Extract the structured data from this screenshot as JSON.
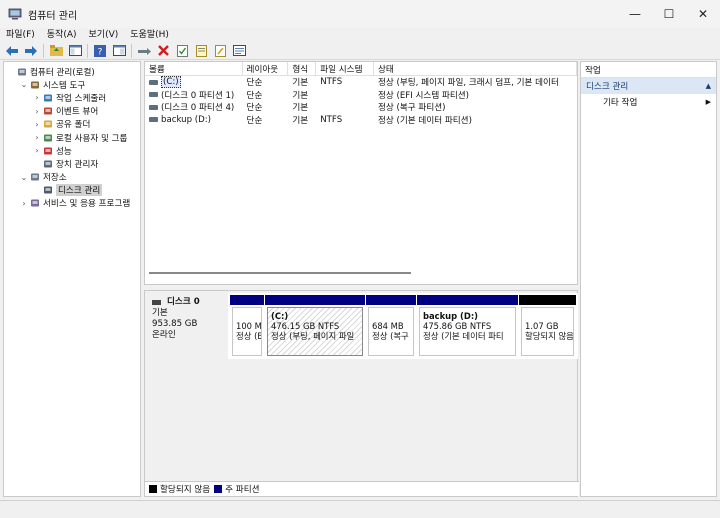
{
  "window": {
    "title": "컴퓨터 관리",
    "minimize": "—",
    "maximize": "☐",
    "close": "✕"
  },
  "menu": [
    "파일(F)",
    "동작(A)",
    "보기(V)",
    "도움말(H)"
  ],
  "tree": [
    {
      "label": "컴퓨터 관리(로컬)",
      "indent": 0,
      "arrow": "",
      "icon": "computer-icon"
    },
    {
      "label": "시스템 도구",
      "indent": 1,
      "arrow": "⌄",
      "icon": "tools-icon"
    },
    {
      "label": "작업 스케줄러",
      "indent": 2,
      "arrow": "›",
      "icon": "clock-icon"
    },
    {
      "label": "이벤트 뷰어",
      "indent": 2,
      "arrow": "›",
      "icon": "event-viewer-icon"
    },
    {
      "label": "공유 폴더",
      "indent": 2,
      "arrow": "›",
      "icon": "shared-folder-icon"
    },
    {
      "label": "로컬 사용자 및 그룹",
      "indent": 2,
      "arrow": "›",
      "icon": "users-icon"
    },
    {
      "label": "성능",
      "indent": 2,
      "arrow": "›",
      "icon": "performance-icon"
    },
    {
      "label": "장치 관리자",
      "indent": 2,
      "arrow": "",
      "icon": "device-manager-icon"
    },
    {
      "label": "저장소",
      "indent": 1,
      "arrow": "⌄",
      "icon": "storage-icon"
    },
    {
      "label": "디스크 관리",
      "indent": 2,
      "arrow": "",
      "icon": "disk-management-icon",
      "selected": true
    },
    {
      "label": "서비스 및 응용 프로그램",
      "indent": 1,
      "arrow": "›",
      "icon": "services-icon"
    }
  ],
  "volumes": {
    "headers": [
      "볼륨",
      "레이아웃",
      "형식",
      "파일 시스템",
      "상태"
    ],
    "rows": [
      [
        "(C:)",
        "단순",
        "기본",
        "NTFS",
        "정상 (부팅, 페이지 파일, 크래시 덤프, 기본 데이터"
      ],
      [
        "(디스크 0 파티션 1)",
        "단순",
        "기본",
        "",
        "정상 (EFI 시스템 파티션)"
      ],
      [
        "(디스크 0 파티션 4)",
        "단순",
        "기본",
        "",
        "정상 (복구 파티션)"
      ],
      [
        "backup (D:)",
        "단순",
        "기본",
        "NTFS",
        "정상 (기본 데이터 파티션)"
      ]
    ]
  },
  "disk": {
    "name": "디스크 0",
    "type": "기본",
    "size": "953.85 GB",
    "status": "온라인",
    "partitions": [
      {
        "title": "",
        "size": "100 MB",
        "status": "정상 (EFI"
      },
      {
        "title": "(C:)",
        "size": "476.15 GB NTFS",
        "status": "정상 (부팅, 페이지 파일"
      },
      {
        "title": "",
        "size": "684 MB",
        "status": "정상 (복구"
      },
      {
        "title": "backup  (D:)",
        "size": "475.86 GB NTFS",
        "status": "정상 (기본 데이터 파티"
      },
      {
        "title": "",
        "size": "1.07 GB",
        "status": "할당되지 않음"
      }
    ]
  },
  "legend": {
    "unallocated": "할당되지 않음",
    "primary": "주 파티션"
  },
  "actions": {
    "header": "작업",
    "selected": "디스크 관리",
    "item": "기타 작업"
  },
  "colors": {
    "primary": "#000080",
    "unallocated": "#000000",
    "selection": "#dbe7f4"
  }
}
